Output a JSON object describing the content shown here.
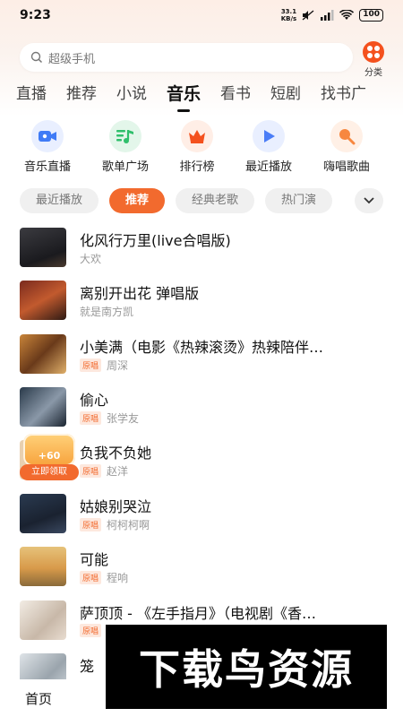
{
  "status_bar": {
    "time": "9:23",
    "speed_value": "33.1",
    "speed_unit": "KB/s",
    "battery": "100"
  },
  "search": {
    "placeholder": "超级手机"
  },
  "category_button": {
    "label": "分类"
  },
  "tabs": [
    {
      "label": "直播"
    },
    {
      "label": "推荐"
    },
    {
      "label": "小说"
    },
    {
      "label": "音乐"
    },
    {
      "label": "看书"
    },
    {
      "label": "短剧"
    },
    {
      "label": "找书广"
    }
  ],
  "active_tab": "音乐",
  "quick_entries": [
    {
      "label": "音乐直播",
      "icon": "live-camera-icon"
    },
    {
      "label": "歌单广场",
      "icon": "playlist-icon"
    },
    {
      "label": "排行榜",
      "icon": "crown-icon"
    },
    {
      "label": "最近播放",
      "icon": "play-icon"
    },
    {
      "label": "嗨唱歌曲",
      "icon": "microphone-icon"
    }
  ],
  "chips": [
    {
      "label": "最近播放"
    },
    {
      "label": "推荐"
    },
    {
      "label": "经典老歌"
    },
    {
      "label": "热门演"
    }
  ],
  "active_chip": "推荐",
  "songs": [
    {
      "title": "化风行万里(live合唱版)",
      "tag": "",
      "artist": "大欢"
    },
    {
      "title": "离别开出花 弹唱版",
      "tag": "",
      "artist": "就是南方凯"
    },
    {
      "title": "小美满（电影《热辣滚烫》热辣陪伴…",
      "tag": "原唱",
      "artist": "周深"
    },
    {
      "title": "偷心",
      "tag": "原唱",
      "artist": "张学友"
    },
    {
      "title": "负我不负她",
      "tag": "原唱",
      "artist": "赵洋"
    },
    {
      "title": "姑娘别哭泣",
      "tag": "原唱",
      "artist": "柯柯柯啊"
    },
    {
      "title": "可能",
      "tag": "原唱",
      "artist": "程响"
    },
    {
      "title": "萨顶顶 - 《左手指月》（电视剧《香…",
      "tag": "原唱",
      "artist": ""
    },
    {
      "title": "笼",
      "tag": "",
      "artist": ""
    }
  ],
  "reward": {
    "amount": "+60",
    "button": "立即领取"
  },
  "bottom_nav": {
    "home": "首页"
  },
  "watermark": {
    "text": "下载鸟资源"
  },
  "colors": {
    "accent": "#f26a2e",
    "tag_bg": "#fde8de"
  }
}
